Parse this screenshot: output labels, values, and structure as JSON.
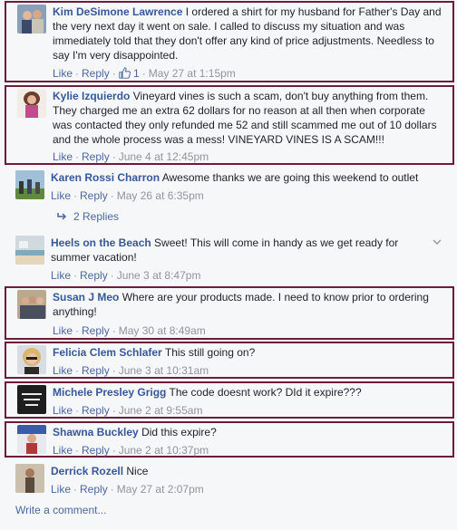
{
  "comments": [
    {
      "author": "Kim DeSimone Lawrence",
      "text": "I ordered a shirt for my husband for Father's Day and the very next day it went on sale. I called to discuss my situation and was immediately told that they don't offer any kind of price adjustments. Needless to say I'm very disappointed.",
      "like": "Like",
      "reply": "Reply",
      "like_count": "1",
      "date": "May 27 at 1:15pm"
    },
    {
      "author": "Kylie Izquierdo",
      "text": "Vineyard vines is such a scam, don't buy anything from them. They charged me an extra 62 dollars for no reason at all then when corporate was contacted they only refunded me 52 and still scammed me out of 10 dollars and the whole process was a mess! VINEYARD VINES IS A SCAM!!!",
      "like": "Like",
      "reply": "Reply",
      "date": "June 4 at 12:45pm"
    },
    {
      "author": "Karen Rossi Charron",
      "text": "Awesome thanks we are going this weekend to outlet",
      "like": "Like",
      "reply": "Reply",
      "date": "May 26 at 6:35pm",
      "replies_label": "2 Replies"
    },
    {
      "author": "Heels on the Beach",
      "text": "Sweet! This will come in handy as we get ready for summer vacation!",
      "like": "Like",
      "reply": "Reply",
      "date": "June 3 at 8:47pm"
    },
    {
      "author": "Susan J Meo",
      "text": "Where are your products made. I need to know prior to ordering anything!",
      "like": "Like",
      "reply": "Reply",
      "date": "May 30 at 8:49am"
    },
    {
      "author": "Felicia Clem Schlafer",
      "text": "This still going on?",
      "like": "Like",
      "reply": "Reply",
      "date": "June 3 at 10:31am"
    },
    {
      "author": "Michele Presley Grigg",
      "text": "The code doesnt work? DId it expire???",
      "like": "Like",
      "reply": "Reply",
      "date": "June 2 at 9:55am"
    },
    {
      "author": "Shawna Buckley",
      "text": "Did this expire?",
      "like": "Like",
      "reply": "Reply",
      "date": "June 2 at 10:37pm"
    },
    {
      "author": "Derrick Rozell",
      "text": "Nice",
      "like": "Like",
      "reply": "Reply",
      "date": "May 27 at 2:07pm"
    }
  ],
  "write_comment": "Write a comment...",
  "colors": {
    "link": "#365899",
    "meta": "#90949c",
    "highlight_border": "#6e1b3a"
  }
}
